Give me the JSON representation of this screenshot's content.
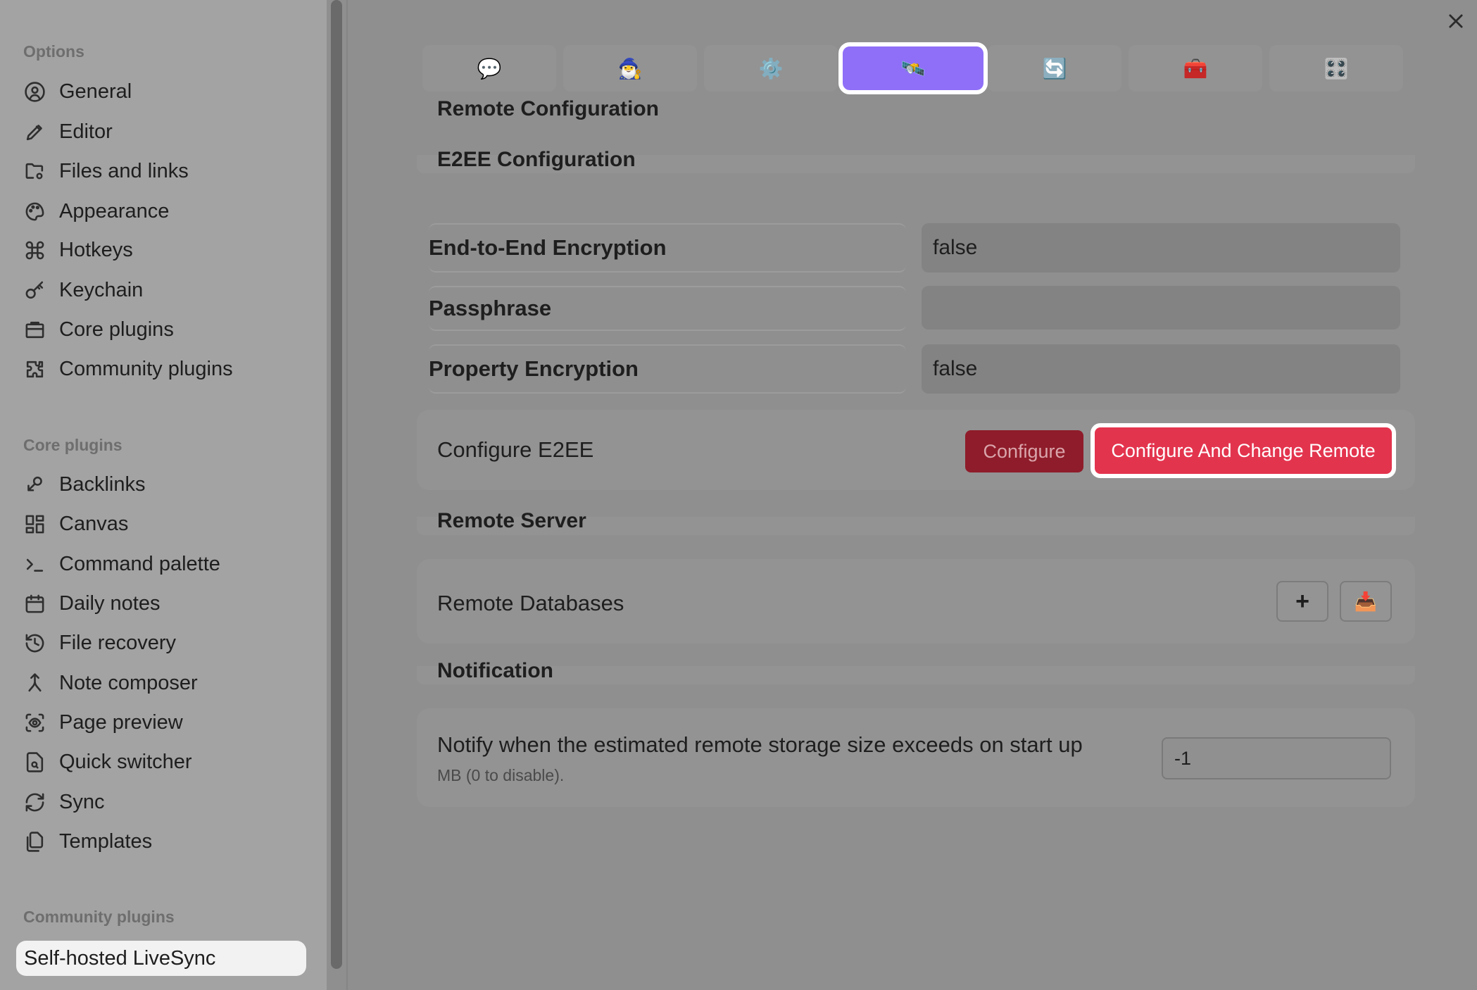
{
  "sidebar": {
    "options_heading": "Options",
    "options": [
      {
        "label": "General",
        "icon": "user-circle-icon"
      },
      {
        "label": "Editor",
        "icon": "pencil-icon"
      },
      {
        "label": "Files and links",
        "icon": "folder-cog-icon"
      },
      {
        "label": "Appearance",
        "icon": "palette-icon"
      },
      {
        "label": "Hotkeys",
        "icon": "command-icon"
      },
      {
        "label": "Keychain",
        "icon": "key-icon"
      },
      {
        "label": "Core plugins",
        "icon": "briefcase-icon"
      },
      {
        "label": "Community plugins",
        "icon": "puzzle-icon"
      }
    ],
    "core_heading": "Core plugins",
    "core": [
      {
        "label": "Backlinks",
        "icon": "backlinks-icon"
      },
      {
        "label": "Canvas",
        "icon": "layout-dashboard-icon"
      },
      {
        "label": "Command palette",
        "icon": "terminal-icon"
      },
      {
        "label": "Daily notes",
        "icon": "calendar-icon"
      },
      {
        "label": "File recovery",
        "icon": "history-icon"
      },
      {
        "label": "Note composer",
        "icon": "merge-icon"
      },
      {
        "label": "Page preview",
        "icon": "scan-eye-icon"
      },
      {
        "label": "Quick switcher",
        "icon": "file-search-icon"
      },
      {
        "label": "Sync",
        "icon": "refresh-icon"
      },
      {
        "label": "Templates",
        "icon": "files-icon"
      }
    ],
    "community_heading": "Community plugins",
    "active_plugin": "Self-hosted LiveSync"
  },
  "tabs": [
    {
      "icon": "speech-bubble-icon",
      "glyph": "💬"
    },
    {
      "icon": "wizard-icon",
      "glyph": "🧙‍♂️"
    },
    {
      "icon": "gear-icon",
      "glyph": "⚙️"
    },
    {
      "icon": "satellite-icon",
      "glyph": "🛰️",
      "active": true
    },
    {
      "icon": "sync-arrows-icon",
      "glyph": "🔄"
    },
    {
      "icon": "toolbox-icon",
      "glyph": "🧰"
    },
    {
      "icon": "control-knobs-icon",
      "glyph": "🎛️"
    }
  ],
  "main": {
    "remote_configuration": "Remote Configuration",
    "e2ee_configuration": "E2EE Configuration",
    "e2ee_rows": [
      {
        "label": "End-to-End Encryption",
        "value": "false"
      },
      {
        "label": "Passphrase",
        "value": ""
      },
      {
        "label": "Property Encryption",
        "value": "false"
      }
    ],
    "configure_e2ee_label": "Configure E2EE",
    "configure_button": "Configure",
    "configure_change_button": "Configure And Change Remote",
    "remote_server": "Remote Server",
    "remote_databases_label": "Remote Databases",
    "add_button": "+",
    "import_glyph": "📥",
    "notification": "Notification",
    "notify_label": "Notify when the estimated remote storage size exceeds on start up",
    "notify_desc": "MB (0 to disable).",
    "notify_value": "-1"
  },
  "colors": {
    "accent_tab": "#8f6ff7",
    "danger": "#e3344e",
    "danger_dim": "#8f1c2a"
  }
}
